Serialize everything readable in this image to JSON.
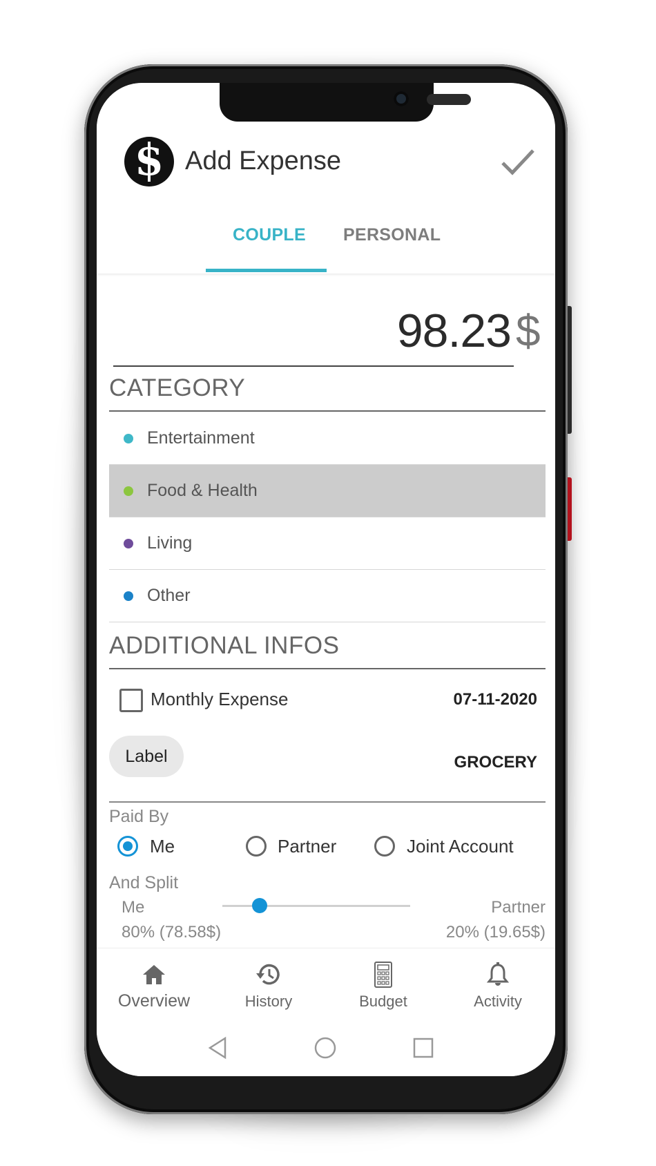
{
  "app": {
    "title": "Add Expense",
    "confirm_icon": "check-icon"
  },
  "tabs": [
    {
      "label": "COUPLE",
      "active": true
    },
    {
      "label": "PERSONAL",
      "active": false
    }
  ],
  "amount": {
    "value": "98.23",
    "currency": "$"
  },
  "category": {
    "heading": "CATEGORY",
    "items": [
      {
        "label": "Entertainment",
        "color": "#3fb8c8",
        "selected": false
      },
      {
        "label": "Food & Health",
        "color": "#8cc63f",
        "selected": true
      },
      {
        "label": "Living",
        "color": "#6f4c9b",
        "selected": false
      },
      {
        "label": "Other",
        "color": "#1b82c8",
        "selected": false
      }
    ]
  },
  "additional": {
    "heading": "ADDITIONAL INFOS",
    "monthly_label": "Monthly Expense",
    "monthly_checked": false,
    "date": "07-11-2020",
    "label_chip": "Label",
    "label_value": "GROCERY"
  },
  "paid_by": {
    "heading": "Paid By",
    "options": [
      {
        "label": "Me",
        "checked": true
      },
      {
        "label": "Partner",
        "checked": false
      },
      {
        "label": "Joint Account",
        "checked": false
      }
    ]
  },
  "split": {
    "heading": "And Split",
    "left_name": "Me",
    "left_value": "80% (78.58$)",
    "right_name": "Partner",
    "right_value": "20% (19.65$)",
    "me_share_fraction": 0.8
  },
  "nav": [
    {
      "label": "Overview",
      "icon": "home-icon",
      "active": true
    },
    {
      "label": "History",
      "icon": "history-icon",
      "active": false
    },
    {
      "label": "Budget",
      "icon": "calculator-icon",
      "active": false
    },
    {
      "label": "Activity",
      "icon": "bell-icon",
      "active": false
    }
  ],
  "colors": {
    "accent": "#38b3c7",
    "radio": "#1493d6"
  }
}
